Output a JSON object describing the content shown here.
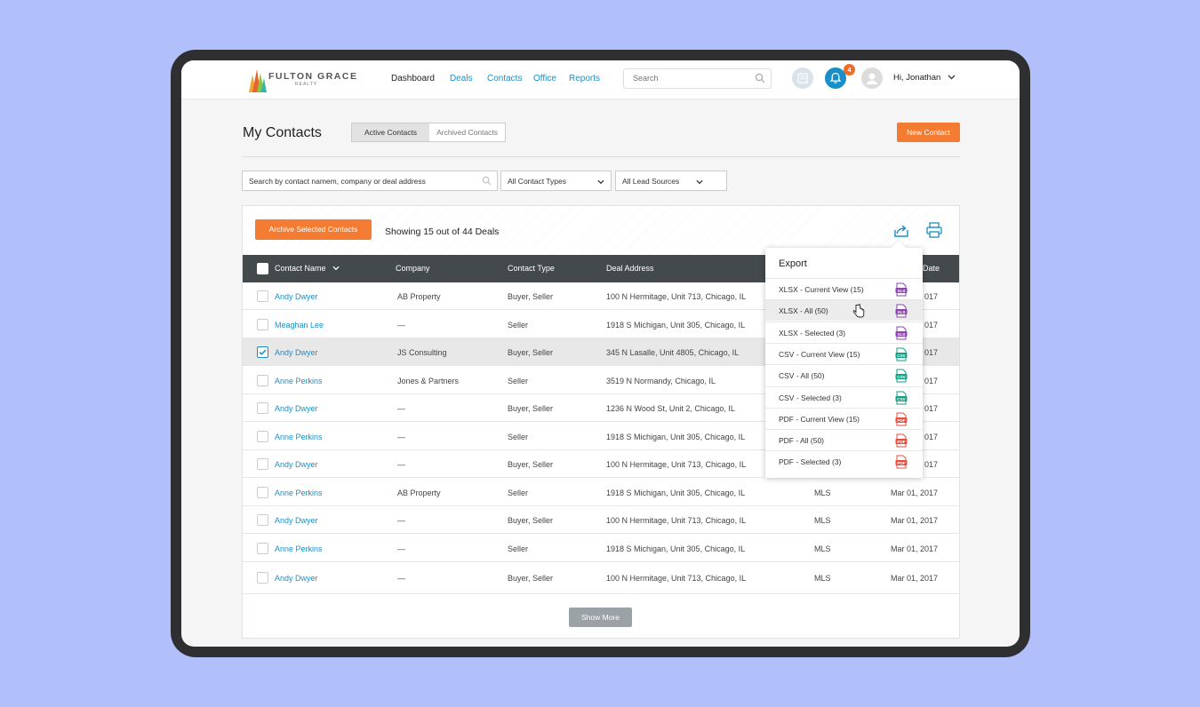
{
  "header": {
    "logo_title": "FULTON GRACE",
    "logo_sub": "REALTY",
    "nav": [
      {
        "label": "Dashboard"
      },
      {
        "label": "Deals"
      },
      {
        "label": "Contacts"
      },
      {
        "label": "Office"
      },
      {
        "label": "Reports"
      }
    ],
    "search_placeholder": "Search",
    "notifications_count": "4",
    "greeting": "Hi, Jonathan",
    "colors": {
      "accent": "#1a8fc7",
      "brand_orange": "#f47b32"
    }
  },
  "page": {
    "title": "My Contacts",
    "tabs": [
      {
        "label": "Active Contacts"
      },
      {
        "label": "Archived Contacts"
      }
    ],
    "new_contact_label": "New Contact"
  },
  "filters": {
    "search_placeholder": "Search by contact namem, company or deal address",
    "contact_type": "All Contact Types",
    "lead_source": "All Lead Sources"
  },
  "toolbar": {
    "archive_label": "Archive Selected Contacts",
    "showing_text": "Showing 15 out of 44 Deals"
  },
  "table": {
    "columns": [
      "Contact Name",
      "Company",
      "Contact Type",
      "Deal Address",
      "Date"
    ],
    "rows": [
      {
        "name": "Andy Dwyer",
        "company": "AB Property",
        "type": "Buyer, Seller",
        "address": "100 N Hermitage, Unit 713, Chicago, IL",
        "source": "",
        "date": "017",
        "checked": false
      },
      {
        "name": "Meaghan Lee",
        "company": "—",
        "type": "Seller",
        "address": "1918 S Michigan, Unit 305, Chicago, IL",
        "source": "",
        "date": "017",
        "checked": false
      },
      {
        "name": "Andy Dwyer",
        "company": "JS Consulting",
        "type": "Buyer, Seller",
        "address": "345 N Lasalle, Unit 4805, Chicago, IL",
        "source": "",
        "date": "017",
        "checked": true
      },
      {
        "name": "Anne Perkins",
        "company": "Jones & Partners",
        "type": "Seller",
        "address": "3519 N Normandy, Chicago, IL",
        "source": "",
        "date": "017",
        "checked": false
      },
      {
        "name": "Andy Dwyer",
        "company": "—",
        "type": "Buyer, Seller",
        "address": "1236 N Wood St, Unit 2, Chicago, IL",
        "source": "",
        "date": "017",
        "checked": false
      },
      {
        "name": "Anne Perkins",
        "company": "—",
        "type": "Seller",
        "address": "1918 S Michigan, Unit 305, Chicago, IL",
        "source": "",
        "date": "017",
        "checked": false
      },
      {
        "name": "Andy Dwyer",
        "company": "—",
        "type": "Buyer, Seller",
        "address": "100 N Hermitage, Unit 713, Chicago, IL",
        "source": "",
        "date": "017",
        "checked": false
      },
      {
        "name": "Anne Perkins",
        "company": "AB Property",
        "type": "Seller",
        "address": "1918 S Michigan, Unit 305, Chicago, IL",
        "source": "MLS",
        "date": "Mar 01, 2017",
        "checked": false
      },
      {
        "name": "Andy Dwyer",
        "company": "—",
        "type": "Buyer, Seller",
        "address": "100 N Hermitage, Unit 713, Chicago, IL",
        "source": "MLS",
        "date": "Mar 01, 2017",
        "checked": false
      },
      {
        "name": "Anne Perkins",
        "company": "—",
        "type": "Seller",
        "address": "1918 S Michigan, Unit 305, Chicago, IL",
        "source": "MLS",
        "date": "Mar 01, 2017",
        "checked": false
      },
      {
        "name": "Andy Dwyer",
        "company": "—",
        "type": "Buyer, Seller",
        "address": "100 N Hermitage, Unit 713, Chicago, IL",
        "source": "MLS",
        "date": "Mar 01, 2017",
        "checked": false
      }
    ],
    "show_more_label": "Show More"
  },
  "export_menu": {
    "title": "Export",
    "items": [
      {
        "label": "XLSX - Current View (15)",
        "file": "XLS",
        "color": "#8e44ad"
      },
      {
        "label": "XLSX - All (50)",
        "file": "XLS",
        "color": "#8e44ad"
      },
      {
        "label": "XLSX - Selected (3)",
        "file": "XLS",
        "color": "#8e44ad"
      },
      {
        "label": "CSV - Current View (15)",
        "file": "CSV",
        "color": "#16a085"
      },
      {
        "label": "CSV - All (50)",
        "file": "CSV",
        "color": "#16a085"
      },
      {
        "label": "CSV - Selected (3)",
        "file": "CSV",
        "color": "#16a085"
      },
      {
        "label": "PDF - Current View (15)",
        "file": "PDF",
        "color": "#e74c3c"
      },
      {
        "label": "PDF - All (50)",
        "file": "PDF",
        "color": "#e74c3c"
      },
      {
        "label": "PDF - Selected (3)",
        "file": "PDF",
        "color": "#e74c3c"
      }
    ]
  }
}
